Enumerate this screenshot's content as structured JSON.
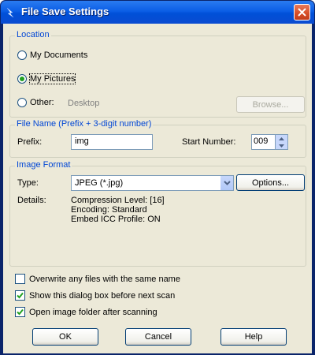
{
  "window": {
    "title": "File Save Settings"
  },
  "location": {
    "legend": "Location",
    "radios": [
      {
        "label": "My Documents",
        "selected": false
      },
      {
        "label": "My Pictures",
        "selected": true
      },
      {
        "label": "Other:",
        "selected": false
      }
    ],
    "other_path": "Desktop",
    "browse_label": "Browse..."
  },
  "filename": {
    "legend": "File Name (Prefix + 3-digit number)",
    "prefix_label": "Prefix:",
    "prefix_value": "img",
    "start_label": "Start Number:",
    "start_value": "009"
  },
  "image_format": {
    "legend": "Image Format",
    "type_label": "Type:",
    "type_value": "JPEG (*.jpg)",
    "options_label": "Options...",
    "details_label": "Details:",
    "details": [
      "Compression Level: [16]",
      "Encoding: Standard",
      "Embed ICC Profile: ON"
    ]
  },
  "checkboxes": [
    {
      "label": "Overwrite any files with the same name",
      "checked": false
    },
    {
      "label": "Show this dialog box before next scan",
      "checked": true
    },
    {
      "label": "Open image folder after scanning",
      "checked": true
    }
  ],
  "buttons": {
    "ok": "OK",
    "cancel": "Cancel",
    "help": "Help"
  },
  "colors": {
    "title_bar": "#0054e3",
    "legend_text": "#0046d5",
    "dialog_bg": "#ece9d8",
    "close_button": "#d64c26",
    "radio_dot": "#21a121"
  }
}
